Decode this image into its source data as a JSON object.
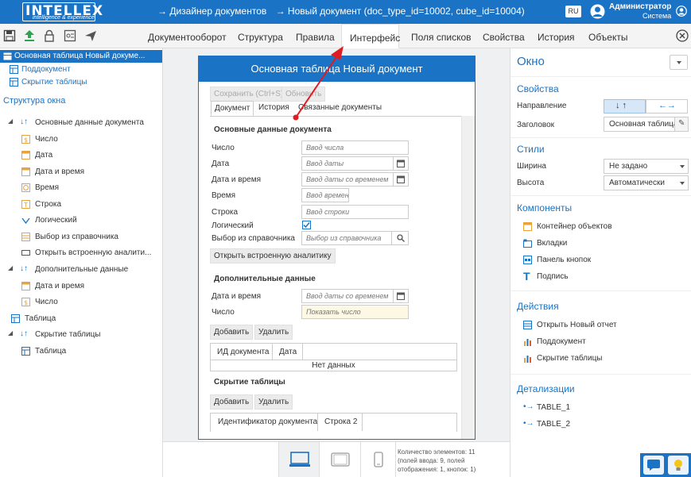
{
  "header": {
    "logo_big": "INTELLEX",
    "logo_small": "intelligence & experience",
    "breadcrumb1": "→ Дизайнер документов",
    "breadcrumb2": "→ Новый документ (doc_type_id=10002, cube_id=10004)",
    "lang": "RU",
    "user_name": "Администратор",
    "user_role": "Система"
  },
  "tabs": [
    "Документооборот",
    "Структура",
    "Правила",
    "Интерфейс",
    "Поля списков",
    "Свойства",
    "История",
    "Объекты"
  ],
  "active_tab": "Интерфейс",
  "left": {
    "selected": "Основная таблица Новый докуме...",
    "items": [
      "Поддокумент",
      "Скрытие таблицы"
    ],
    "structure_title": "Структура окна",
    "tree": [
      "Основные данные документа",
      "Число",
      "Дата",
      "Дата и время",
      "Время",
      "Строка",
      "Логический",
      "Выбор из справочника",
      "Открыть встроенную аналити...",
      "Дополнительные данные",
      "Дата и время",
      "Число",
      "Таблица",
      "Скрытие таблицы",
      "Таблица"
    ]
  },
  "doc": {
    "title": "Основная таблица Новый документ",
    "save": "Сохранить (Ctrl+S)",
    "refresh": "Обновить",
    "tabs": [
      "Документ",
      "История",
      "Связанные документы"
    ],
    "section1": "Основные данные документа",
    "fields": [
      {
        "label": "Число",
        "placeholder": "Ввод числа"
      },
      {
        "label": "Дата",
        "placeholder": "Ввод даты"
      },
      {
        "label": "Дата и время",
        "placeholder": "Ввод даты со временем"
      },
      {
        "label": "Время",
        "placeholder": "Ввод времени"
      },
      {
        "label": "Строка",
        "placeholder": "Ввод строки"
      },
      {
        "label": "Логический",
        "placeholder": ""
      },
      {
        "label": "Выбор из справочника",
        "placeholder": "Выбор из справочника"
      }
    ],
    "open_analytics": "Открыть встроенную аналитику",
    "section2": "Дополнительные данные",
    "fields2": [
      {
        "label": "Дата и время",
        "placeholder": "Ввод даты со временем"
      },
      {
        "label": "Число",
        "placeholder": "Показать число"
      }
    ],
    "add": "Добавить",
    "delete": "Удалить",
    "table_cols": [
      "ИД документа",
      "Дата"
    ],
    "no_data": "Нет данных",
    "section3": "Скрытие таблицы",
    "table2_cols": [
      "Идентификатор документа",
      "Строка 2"
    ]
  },
  "footer": {
    "count_line1": "Количество элементов: 11",
    "count_line2": "(полей ввода: 9, полей",
    "count_line3": "отображения: 1, кнопок: 1)"
  },
  "right": {
    "title": "Окно",
    "props_title": "Свойства",
    "direction_label": "Направление",
    "caption_label": "Заголовок",
    "caption_value": "Основная таблица",
    "styles_title": "Стили",
    "width_label": "Ширина",
    "width_value": "Не задано",
    "height_label": "Высота",
    "height_value": "Автоматически",
    "components_title": "Компоненты",
    "components": [
      "Контейнер объектов",
      "Вкладки",
      "Панель кнопок",
      "Подпись"
    ],
    "actions_title": "Действия",
    "actions": [
      "Открыть Новый отчет",
      "Поддокумент",
      "Скрытие таблицы"
    ],
    "detail_title": "Детализации",
    "details": [
      "TABLE_1",
      "TABLE_2"
    ]
  },
  "colors": {
    "accent": "#1a73c5",
    "arrow": "#e01b22"
  }
}
